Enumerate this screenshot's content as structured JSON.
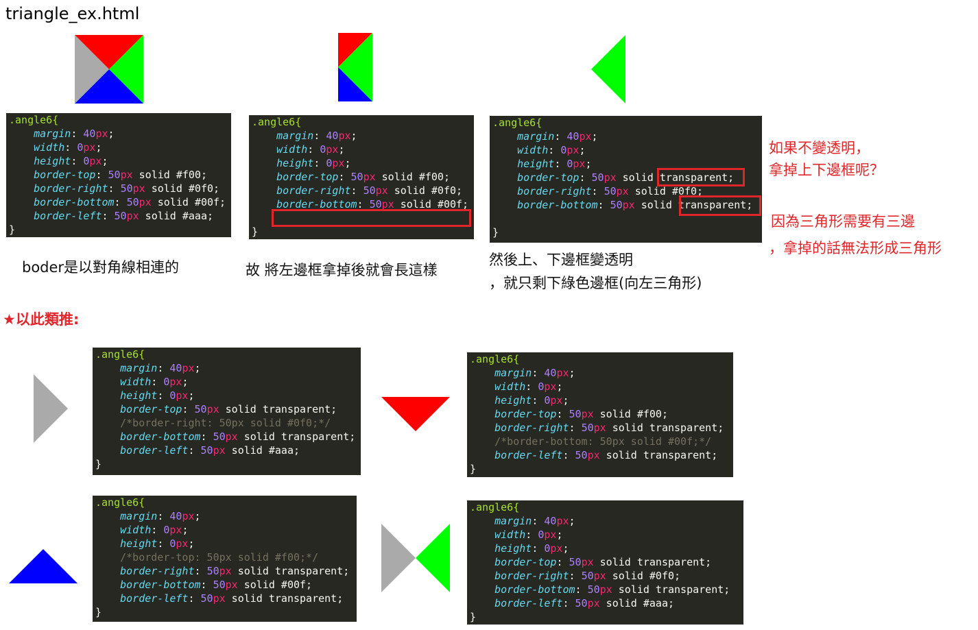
{
  "title": "triangle_ex.html",
  "captions": {
    "c1": "boder是以對角線相連的",
    "c2": "故 將左邊框拿掉後就會長這樣",
    "c3a": "然後上、下邊框變透明",
    "c3b": "，就只剩下綠色邊框(向左三角形)"
  },
  "notes": {
    "n1a": "如果不變透明，",
    "n1b": "拿掉上下邊框呢？",
    "n2a": "因為三角形需要有三邊",
    "n2b": "，拿掉的話無法形成三角形"
  },
  "section_label": "★以此類推:",
  "colors": {
    "red": "#ff0000",
    "green": "#00ff00",
    "blue": "#0000ff",
    "gray": "#aaaaaa",
    "accent": "#e0262a",
    "code_bg": "#272822"
  },
  "code_blocks": {
    "b1": {
      "selector": ".angle6{",
      "lines": [
        [
          "margin",
          "40",
          "px",
          ";",
          ""
        ],
        [
          "width",
          "0",
          "px",
          ";",
          ""
        ],
        [
          "height",
          "0",
          "px",
          ";",
          ""
        ],
        [
          "border-top",
          "50",
          "px",
          " solid #f00;",
          ""
        ],
        [
          "border-right",
          "50",
          "px",
          " solid #0f0;",
          ""
        ],
        [
          "border-bottom",
          "50",
          "px",
          " solid #00f;",
          ""
        ],
        [
          "border-left",
          "50",
          "px",
          " solid #aaa;",
          ""
        ]
      ],
      "close": "}"
    },
    "b2": {
      "selector": ".angle6{",
      "lines": [
        [
          "margin",
          "40",
          "px",
          ";",
          ""
        ],
        [
          "width",
          "0",
          "px",
          ";",
          ""
        ],
        [
          "height",
          "0",
          "px",
          ";",
          ""
        ],
        [
          "border-top",
          "50",
          "px",
          " solid #f00;",
          ""
        ],
        [
          "border-right",
          "50",
          "px",
          " solid #0f0;",
          ""
        ],
        [
          "border-bottom",
          "50",
          "px",
          " solid #00f;",
          ""
        ],
        [
          "",
          "",
          "",
          "",
          ""
        ]
      ],
      "close": "}"
    },
    "b3": {
      "selector": ".angle6{",
      "lines": [
        [
          "margin",
          "40",
          "px",
          ";",
          ""
        ],
        [
          "width",
          "0",
          "px",
          ";",
          ""
        ],
        [
          "height",
          "0",
          "px",
          ";",
          ""
        ],
        [
          "border-top",
          "50",
          "px",
          " solid transparent;",
          ""
        ],
        [
          "border-right",
          "50",
          "px",
          " solid #0f0;",
          ""
        ],
        [
          "border-bottom",
          "50",
          "px",
          " solid transparent;",
          ""
        ],
        [
          "",
          "",
          "",
          "",
          ""
        ]
      ],
      "close": "}"
    },
    "b4": {
      "selector": ".angle6{",
      "lines": [
        [
          "margin",
          "40",
          "px",
          ";",
          ""
        ],
        [
          "width",
          "0",
          "px",
          ";",
          ""
        ],
        [
          "height",
          "0",
          "px",
          ";",
          ""
        ],
        [
          "border-top",
          "50",
          "px",
          " solid transparent;",
          ""
        ],
        [
          "",
          "",
          "",
          "",
          "/*border-right: 50px solid #0f0;*/"
        ],
        [
          "border-bottom",
          "50",
          "px",
          " solid transparent;",
          ""
        ],
        [
          "border-left",
          "50",
          "px",
          " solid #aaa;",
          ""
        ]
      ],
      "close": "}"
    },
    "b5": {
      "selector": ".angle6{",
      "lines": [
        [
          "margin",
          "40",
          "px",
          ";",
          ""
        ],
        [
          "width",
          "0",
          "px",
          ";",
          ""
        ],
        [
          "height",
          "0",
          "px",
          ";",
          ""
        ],
        [
          "border-top",
          "50",
          "px",
          " solid #f00;",
          ""
        ],
        [
          "border-right",
          "50",
          "px",
          " solid transparent;",
          ""
        ],
        [
          "",
          "",
          "",
          "",
          "/*border-bottom: 50px solid #00f;*/"
        ],
        [
          "border-left",
          "50",
          "px",
          " solid transparent;",
          ""
        ]
      ],
      "close": "}"
    },
    "b6": {
      "selector": ".angle6{",
      "lines": [
        [
          "margin",
          "40",
          "px",
          ";",
          ""
        ],
        [
          "width",
          "0",
          "px",
          ";",
          ""
        ],
        [
          "height",
          "0",
          "px",
          ";",
          ""
        ],
        [
          "",
          "",
          "",
          "",
          "/*border-top: 50px solid #f00;*/"
        ],
        [
          "border-right",
          "50",
          "px",
          " solid transparent;",
          ""
        ],
        [
          "border-bottom",
          "50",
          "px",
          " solid #00f;",
          ""
        ],
        [
          "border-left",
          "50",
          "px",
          " solid transparent;",
          ""
        ]
      ],
      "close": "}"
    },
    "b7": {
      "selector": ".angle6{",
      "lines": [
        [
          "margin",
          "40",
          "px",
          ";",
          ""
        ],
        [
          "width",
          "0",
          "px",
          ";",
          ""
        ],
        [
          "height",
          "0",
          "px",
          ";",
          ""
        ],
        [
          "border-top",
          "50",
          "px",
          " solid transparent;",
          ""
        ],
        [
          "border-right",
          "50",
          "px",
          " solid #0f0;",
          ""
        ],
        [
          "border-bottom",
          "50",
          "px",
          " solid transparent;",
          ""
        ],
        [
          "border-left",
          "50",
          "px",
          " solid #aaa;",
          ""
        ]
      ],
      "close": "}"
    }
  }
}
